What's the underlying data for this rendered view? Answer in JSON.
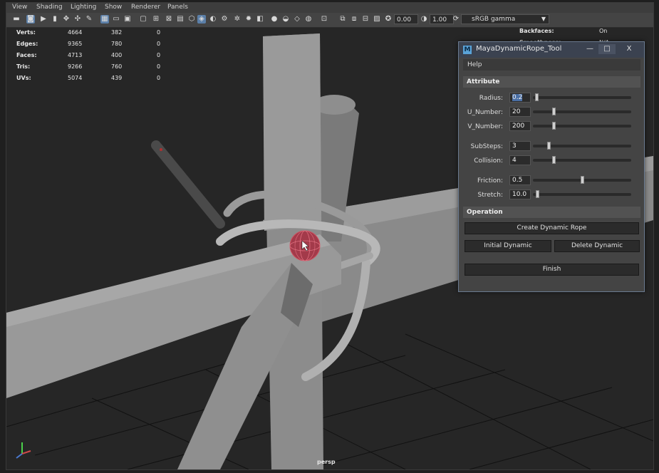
{
  "menubar": {
    "items": [
      "View",
      "Shading",
      "Lighting",
      "Show",
      "Renderer",
      "Panels"
    ]
  },
  "toolbar": {
    "exposure_value": "0.00",
    "gamma_value": "1.00",
    "color_space": "sRGB gamma",
    "icons": [
      "camera-icon",
      "camera-attributes-icon",
      "bookmark-icon",
      "move-icon",
      "snap-icon",
      "pencil-icon",
      "wireframe-icon",
      "smooth-shade-icon",
      "textured-icon",
      "lights-icon",
      "shadows-icon",
      "isolate-icon",
      "xray-icon",
      "lighting-icon",
      "screen-space-icon",
      "gate-icon",
      "exposure-icon",
      "gamma-icon"
    ]
  },
  "hud": {
    "left": {
      "rows": [
        {
          "label": "Verts:",
          "v1": "4664",
          "v2": "382",
          "v3": "0"
        },
        {
          "label": "Edges:",
          "v1": "9365",
          "v2": "780",
          "v3": "0"
        },
        {
          "label": "Faces:",
          "v1": "4713",
          "v2": "400",
          "v3": "0"
        },
        {
          "label": "Tris:",
          "v1": "9266",
          "v2": "760",
          "v3": "0"
        },
        {
          "label": "UVs:",
          "v1": "5074",
          "v2": "439",
          "v3": "0"
        }
      ]
    },
    "right": {
      "rows": [
        {
          "label": "Backfaces:",
          "value": "On"
        },
        {
          "label": "Smoothness:",
          "value": "N/A"
        }
      ]
    },
    "camera_name": "persp"
  },
  "dialog": {
    "title": "MayaDynamicRope_Tool",
    "logo_letter": "M",
    "minimize": "—",
    "maximize": "□",
    "close": "X",
    "menu_help": "Help",
    "attribute_header": "Attribute",
    "fields": [
      {
        "label": "Radius:",
        "value": "0.2",
        "slider": 0.02
      },
      {
        "label": "U_Number:",
        "value": "20",
        "slider": 0.2
      },
      {
        "label": "V_Number:",
        "value": "200",
        "slider": 0.2
      },
      {
        "label": "SubSteps:",
        "value": "3",
        "slider": 0.15
      },
      {
        "label": "Collision:",
        "value": "4",
        "slider": 0.2
      },
      {
        "label": "Friction:",
        "value": "0.5",
        "slider": 0.5
      },
      {
        "label": "Stretch:",
        "value": "10.0",
        "slider": 0.03
      }
    ],
    "operation_header": "Operation",
    "btn_create": "Create Dynamic Rope",
    "btn_initial": "Initial Dynamic",
    "btn_delete": "Delete  Dynamic",
    "btn_finish": "Finish"
  }
}
